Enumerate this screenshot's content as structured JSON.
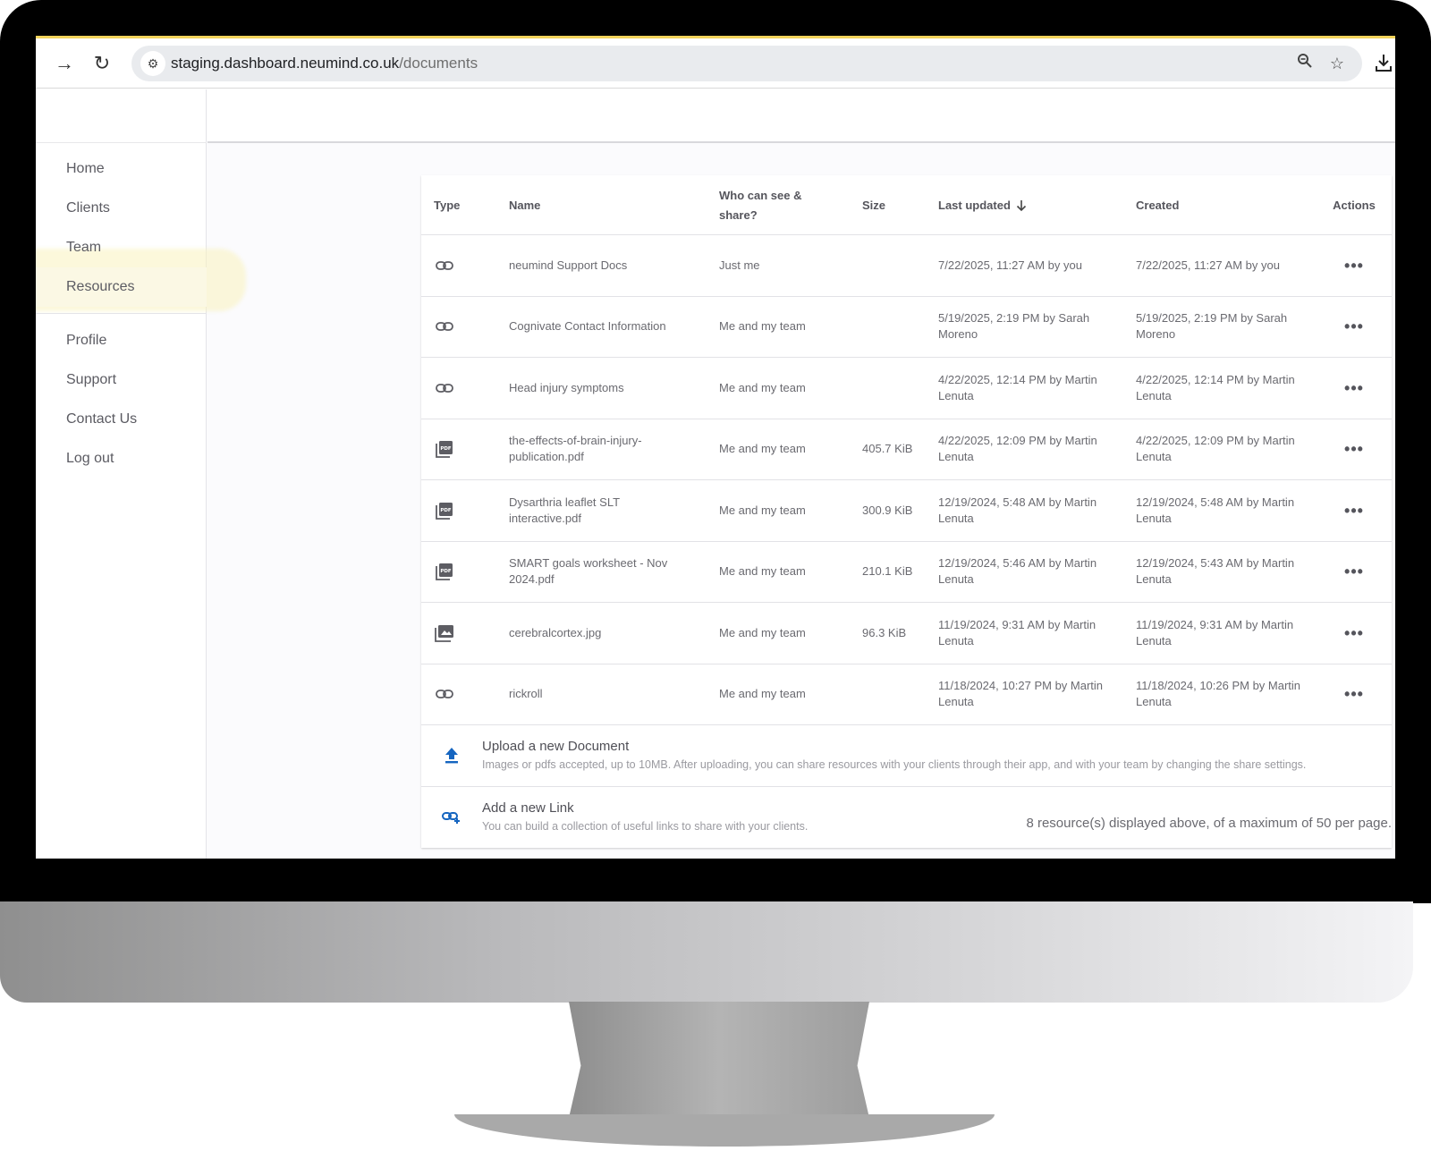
{
  "browser": {
    "url_host": "staging.dashboard.neumind.co.uk",
    "url_path": "/documents"
  },
  "colors": {
    "accent": "#1565c0",
    "active_nav_bg": "#fbf8e4",
    "highlight": "#f2d35a"
  },
  "sidebar": {
    "items": [
      {
        "label": "Home",
        "active": false
      },
      {
        "label": "Clients",
        "active": false
      },
      {
        "label": "Team",
        "active": false
      },
      {
        "label": "Resources",
        "active": true
      },
      {
        "label": "Profile",
        "active": false
      },
      {
        "label": "Support",
        "active": false
      },
      {
        "label": "Contact Us",
        "active": false
      },
      {
        "label": "Log out",
        "active": false
      }
    ]
  },
  "table": {
    "headers": {
      "type": "Type",
      "name": "Name",
      "share": "Who can see & share?",
      "size": "Size",
      "updated": "Last updated",
      "updated_sort_icon": "arrow-down-icon",
      "created": "Created",
      "actions": "Actions"
    },
    "rows": [
      {
        "icon": "link-icon",
        "name": "neumind Support Docs",
        "share": "Just me",
        "size": "",
        "updated": "7/22/2025, 11:27 AM by you",
        "created": "7/22/2025, 11:27 AM by you"
      },
      {
        "icon": "link-icon",
        "name": "Cognivate Contact Information",
        "share": "Me and my team",
        "size": "",
        "updated": "5/19/2025, 2:19 PM by Sarah Moreno",
        "created": "5/19/2025, 2:19 PM by Sarah Moreno"
      },
      {
        "icon": "link-icon",
        "name": "Head injury symptoms",
        "share": "Me and my team",
        "size": "",
        "updated": "4/22/2025, 12:14 PM by Martin Lenuta",
        "created": "4/22/2025, 12:14 PM by Martin Lenuta"
      },
      {
        "icon": "pdf-icon",
        "name": "the-effects-of-brain-injury-publication.pdf",
        "share": "Me and my team",
        "size": "405.7 KiB",
        "updated": "4/22/2025, 12:09 PM by Martin Lenuta",
        "created": "4/22/2025, 12:09 PM by Martin Lenuta"
      },
      {
        "icon": "pdf-icon",
        "name": "Dysarthria leaflet SLT interactive.pdf",
        "share": "Me and my team",
        "size": "300.9 KiB",
        "updated": "12/19/2024, 5:48 AM by Martin Lenuta",
        "created": "12/19/2024, 5:48 AM by Martin Lenuta"
      },
      {
        "icon": "pdf-icon",
        "name": "SMART goals worksheet - Nov 2024.pdf",
        "share": "Me and my team",
        "size": "210.1 KiB",
        "updated": "12/19/2024, 5:46 AM by Martin Lenuta",
        "created": "12/19/2024, 5:43 AM by Martin Lenuta"
      },
      {
        "icon": "image-icon",
        "name": "cerebralcortex.jpg",
        "share": "Me and my team",
        "size": "96.3 KiB",
        "updated": "11/19/2024, 9:31 AM by Martin Lenuta",
        "created": "11/19/2024, 9:31 AM by Martin Lenuta"
      },
      {
        "icon": "link-icon",
        "name": "rickroll",
        "share": "Me and my team",
        "size": "",
        "updated": "11/18/2024, 10:27 PM by Martin Lenuta",
        "created": "11/18/2024, 10:26 PM by Martin Lenuta"
      }
    ]
  },
  "upload": {
    "title": "Upload a new Document",
    "description": "Images or pdfs accepted, up to 10MB. After uploading, you can share resources with your clients through their app, and with your team by changing the share settings."
  },
  "add_link": {
    "title": "Add a new Link",
    "description": "You can build a collection of useful links to share with your clients."
  },
  "footer": {
    "note": "8 resource(s) displayed above, of a maximum of 50 per page."
  }
}
